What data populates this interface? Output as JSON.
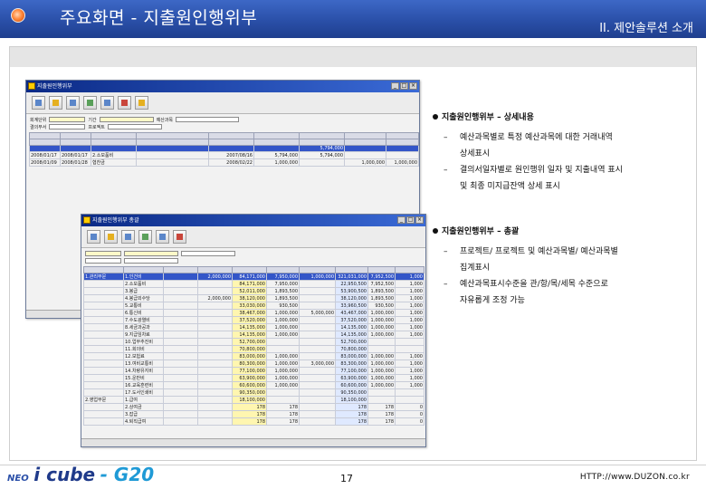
{
  "header": {
    "title": "주요화면 - 지출원인행위부",
    "section": "II. 제안솔루션 소개"
  },
  "detail_section": {
    "heading": "지출원인행위부 – 상세내용",
    "items": [
      "예산과목별로 특정 예산과목에 대한 거래내역",
      "상세표시",
      "결의서일자별로 원인행위 일자 및 지출내역 표시",
      "및 최종 미지급잔액 상세 표시"
    ]
  },
  "summary_section": {
    "heading": "지출원인행위부 – 총괄",
    "items": [
      "프로젝트/ 프로젝트 및 예산과목별/ 예산과목별",
      "집계표시",
      "예산과목표시수준을 관/항/목/세목 수준으로",
      "자유롭게 조정 가능"
    ]
  },
  "detail_window": {
    "title": "지출원인행위부",
    "filters": [
      "회계단위",
      "기간",
      "예산과목",
      "결의부서",
      "프로젝트"
    ],
    "rows": [
      {
        "date": "",
        "no": "",
        "text": "",
        "amt1": "",
        "amt2": "",
        "amt3": "5,794,000",
        "amt4": "",
        "amt5": ""
      },
      {
        "date": "2008/01/17",
        "no": "2008/01/17",
        "text": "2.소모품비",
        "amt1": "2007/08/16",
        "amt2": "5,794,000",
        "amt3": "5,794,000",
        "amt4": "",
        "amt5": ""
      },
      {
        "date": "2008/01/09",
        "no": "2008/01/28",
        "text": "협찬금",
        "amt1": "2008/02/22",
        "amt2": "1,000,000",
        "amt3": "",
        "amt4": "1,000,000",
        "amt5": "1,000,000"
      }
    ]
  },
  "summary_window": {
    "title": "지출원인행위부 총괄",
    "rows": [
      {
        "name": "1.관리부문",
        "sub": "1.인건비",
        "v1": "2,000,000",
        "v2": "84,171,000",
        "v3": "7,950,000",
        "v4": "1,000,000",
        "v5": "321,031,000",
        "v6": "7,952,500",
        "v7": "1,000"
      },
      {
        "name": "",
        "sub": "2.소모품비",
        "v1": "",
        "v2": "84,171,000",
        "v3": "7,950,000",
        "v4": "",
        "v5": "22,950,500",
        "v6": "7,952,500",
        "v7": "1,000"
      },
      {
        "name": "",
        "sub": "3.봉급",
        "v1": "",
        "v2": "52,011,000",
        "v3": "1,893,500",
        "v4": "",
        "v5": "53,900,500",
        "v6": "1,893,500",
        "v7": "1,000"
      },
      {
        "name": "",
        "sub": "4.봉급외수당",
        "v1": "2,000,000",
        "v2": "38,120,000",
        "v3": "1,893,500",
        "v4": "",
        "v5": "38,120,000",
        "v6": "1,893,500",
        "v7": "1,000"
      },
      {
        "name": "",
        "sub": "5.교통비",
        "v1": "",
        "v2": "33,030,000",
        "v3": "930,500",
        "v4": "",
        "v5": "33,960,500",
        "v6": "930,500",
        "v7": "1,000"
      },
      {
        "name": "",
        "sub": "6.통신비",
        "v1": "",
        "v2": "38,467,000",
        "v3": "1,000,000",
        "v4": "5,000,000",
        "v5": "43,467,000",
        "v6": "1,000,000",
        "v7": "1,000"
      },
      {
        "name": "",
        "sub": "7.수도광열비",
        "v1": "",
        "v2": "37,520,000",
        "v3": "1,000,000",
        "v4": "",
        "v5": "37,520,000",
        "v6": "1,000,000",
        "v7": "1,000"
      },
      {
        "name": "",
        "sub": "8.세금과공과",
        "v1": "",
        "v2": "14,135,000",
        "v3": "1,000,000",
        "v4": "",
        "v5": "14,135,000",
        "v6": "1,000,000",
        "v7": "1,000"
      },
      {
        "name": "",
        "sub": "9.지급임차료",
        "v1": "",
        "v2": "14,135,000",
        "v3": "1,000,000",
        "v4": "",
        "v5": "14,135,000",
        "v6": "1,000,000",
        "v7": "1,000"
      },
      {
        "name": "",
        "sub": "10.업무추진비",
        "v1": "",
        "v2": "52,700,000",
        "v3": "",
        "v4": "",
        "v5": "52,700,000",
        "v6": "",
        "v7": ""
      },
      {
        "name": "",
        "sub": "11.회의비",
        "v1": "",
        "v2": "70,800,000",
        "v3": "",
        "v4": "",
        "v5": "70,800,000",
        "v6": "",
        "v7": ""
      },
      {
        "name": "",
        "sub": "12.보험료",
        "v1": "",
        "v2": "83,000,000",
        "v3": "1,000,000",
        "v4": "",
        "v5": "83,000,000",
        "v6": "1,000,000",
        "v7": "1,000"
      },
      {
        "name": "",
        "sub": "13.여비교통비",
        "v1": "",
        "v2": "80,300,000",
        "v3": "1,000,000",
        "v4": "3,000,000",
        "v5": "83,300,000",
        "v6": "1,000,000",
        "v7": "1,000"
      },
      {
        "name": "",
        "sub": "14.차량유지비",
        "v1": "",
        "v2": "77,100,000",
        "v3": "1,000,000",
        "v4": "",
        "v5": "77,100,000",
        "v6": "1,000,000",
        "v7": "1,000"
      },
      {
        "name": "",
        "sub": "15.운반비",
        "v1": "",
        "v2": "63,900,000",
        "v3": "1,000,000",
        "v4": "",
        "v5": "63,900,000",
        "v6": "1,000,000",
        "v7": "1,000"
      },
      {
        "name": "",
        "sub": "16.교육훈련비",
        "v1": "",
        "v2": "60,600,000",
        "v3": "1,000,000",
        "v4": "",
        "v5": "60,600,000",
        "v6": "1,000,000",
        "v7": "1,000"
      },
      {
        "name": "",
        "sub": "17.도서인쇄비",
        "v1": "",
        "v2": "90,350,000",
        "v3": "",
        "v4": "",
        "v5": "90,350,000",
        "v6": "",
        "v7": ""
      },
      {
        "name": "2.영업부문",
        "sub": "1.급여",
        "v1": "",
        "v2": "18,100,000",
        "v3": "",
        "v4": "",
        "v5": "18,100,000",
        "v6": "",
        "v7": ""
      },
      {
        "name": "",
        "sub": "2.상여금",
        "v1": "",
        "v2": "178",
        "v3": "178",
        "v4": "",
        "v5": "178",
        "v6": "178",
        "v7": "0"
      },
      {
        "name": "",
        "sub": "3.잡급",
        "v1": "",
        "v2": "178",
        "v3": "178",
        "v4": "",
        "v5": "178",
        "v6": "178",
        "v7": "0"
      },
      {
        "name": "",
        "sub": "4.퇴직급여",
        "v1": "",
        "v2": "178",
        "v3": "178",
        "v4": "",
        "v5": "178",
        "v6": "178",
        "v7": "0"
      }
    ]
  },
  "footer": {
    "logo_neo": "NEO",
    "logo_main": "i cube",
    "logo_g20": "- G20",
    "page_number": "17",
    "url": "HTTP://www.DUZON.co.kr"
  }
}
